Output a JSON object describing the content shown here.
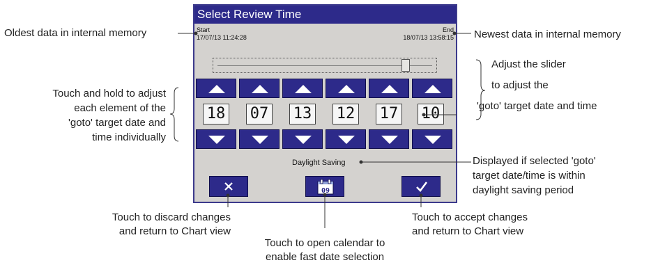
{
  "dialog": {
    "title": "Select Review Time",
    "start_label": "Start",
    "end_label": "End",
    "start_time": "17/07/13 11:24:28",
    "end_time": "18/07/13 13:58:15",
    "slider_position": 0.88,
    "fields": [
      "18",
      "07",
      "13",
      "12",
      "17",
      "10"
    ],
    "daylight_saving": "Daylight Saving",
    "calendar_day": "09"
  },
  "annotations": {
    "oldest": "Oldest data in internal memory",
    "newest": "Newest data in internal memory",
    "slider_lines": [
      "Adjust the slider",
      "to adjust the",
      "'goto' target date and time"
    ],
    "touch_hold_lines": [
      "Touch and hold to adjust",
      "each element of the",
      "'goto' target date and",
      "time individually"
    ],
    "daylight_lines": [
      "Displayed if selected 'goto'",
      "target date/time is within",
      "daylight saving period"
    ],
    "discard_lines": [
      "Touch to discard changes",
      "and return to Chart view"
    ],
    "accept_lines": [
      "Touch to accept changes",
      "and return to Chart view"
    ],
    "calendar_lines": [
      "Touch to open calendar to",
      "enable fast date selection"
    ]
  },
  "colors": {
    "accent": "#2d2a8a",
    "dialog_bg": "#d4d2cf"
  }
}
